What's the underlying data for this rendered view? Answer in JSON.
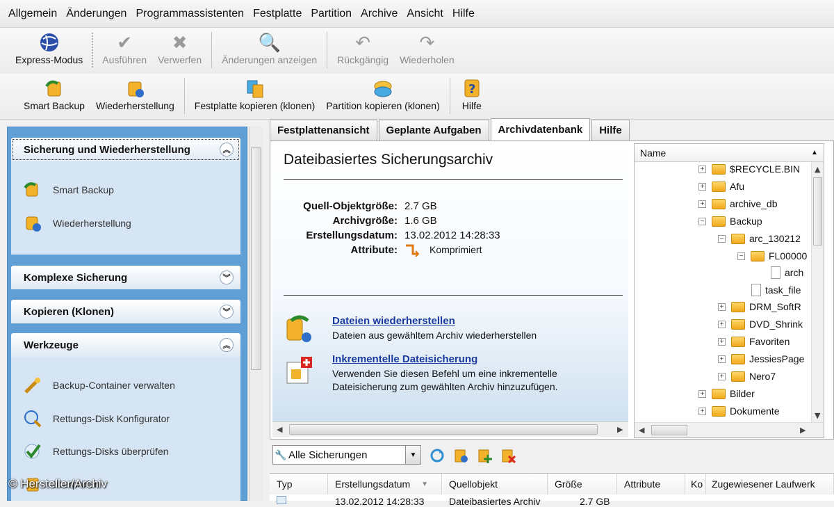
{
  "menu": [
    "Allgemein",
    "Änderungen",
    "Programmassistenten",
    "Festplatte",
    "Partition",
    "Archive",
    "Ansicht",
    "Hilfe"
  ],
  "toolbar1": {
    "express": "Express-Modus",
    "ausfuehren": "Ausführen",
    "verwerfen": "Verwerfen",
    "aenderungen": "Änderungen anzeigen",
    "rueckgaengig": "Rückgängig",
    "wiederholen": "Wiederholen"
  },
  "toolbar2": {
    "smart_backup": "Smart Backup",
    "wiederherstellung": "Wiederherstellung",
    "festplatte_kopieren": "Festplatte kopieren (klonen)",
    "partition_kopieren": "Partition kopieren (klonen)",
    "hilfe": "Hilfe"
  },
  "sidebar": {
    "panel1": {
      "title": "Sicherung und Wiederherstellung",
      "items": [
        "Smart Backup",
        "Wiederherstellung"
      ]
    },
    "panel2": {
      "title": "Komplexe Sicherung"
    },
    "panel3": {
      "title": "Kopieren (Klonen)"
    },
    "panel4": {
      "title": "Werkzeuge",
      "items": [
        "Backup-Container verwalten",
        "Rettungs-Disk Konfigurator",
        "Rettungs-Disks überprüfen",
        "überprüfen"
      ]
    }
  },
  "tabs": [
    "Festplattenansicht",
    "Geplante Aufgaben",
    "Archivdatenbank",
    "Hilfe"
  ],
  "details": {
    "title": "Dateibasiertes Sicherungsarchiv",
    "props": [
      {
        "label": "Quell-Objektgröße:",
        "value": "2.7 GB"
      },
      {
        "label": "Archivgröße:",
        "value": "1.6 GB"
      },
      {
        "label": "Erstellungsdatum:",
        "value": "13.02.2012 14:28:33"
      },
      {
        "label": "Attribute:",
        "value": "Komprimiert"
      }
    ],
    "actions": [
      {
        "link": "Dateien wiederherstellen",
        "desc": "Dateien aus gewähltem Archiv wiederherstellen"
      },
      {
        "link": "Inkrementelle Dateisicherung",
        "desc": "Verwenden Sie diesen Befehl um eine inkrementelle Dateisicherung zum gewählten Archiv hinzuzufügen."
      }
    ]
  },
  "tree": {
    "header": "Name",
    "nodes": [
      "$RECYCLE.BIN",
      "Afu",
      "archive_db",
      "Backup",
      "arc_130212",
      "FL00000",
      "arch",
      "task_file",
      "DRM_SoftR",
      "DVD_Shrink",
      "Favoriten",
      "JessiesPage",
      "Nero7",
      "Bilder",
      "Dokumente"
    ]
  },
  "filter": {
    "selected": "Alle Sicherungen"
  },
  "table": {
    "columns": [
      "Typ",
      "Erstellungsdatum",
      "Quellobjekt",
      "Größe",
      "Attribute",
      "Ko",
      "Zugewiesener Laufwerk"
    ],
    "row": [
      "",
      "13.02.2012 14:28:33",
      "Dateibasiertes Archiv",
      "2.7 GB",
      ""
    ]
  },
  "copyright": "© Hersteller/Archiv"
}
